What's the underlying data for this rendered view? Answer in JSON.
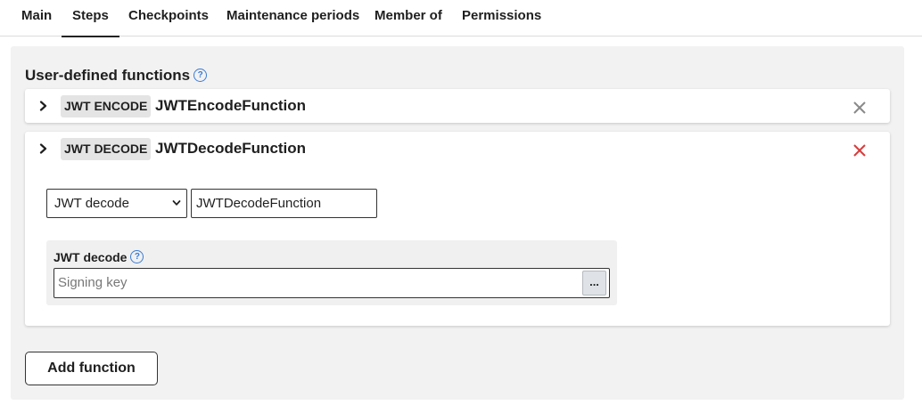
{
  "tabs": [
    {
      "label": "Main"
    },
    {
      "label": "Steps"
    },
    {
      "label": "Checkpoints"
    },
    {
      "label": "Maintenance periods"
    },
    {
      "label": "Member of"
    },
    {
      "label": "Permissions"
    }
  ],
  "active_tab": "Steps",
  "section": {
    "title": "User-defined functions",
    "help_icon": "help-circle-icon"
  },
  "functions": [
    {
      "type_badge": "JWT ENCODE",
      "name": "JWTEncodeFunction",
      "expanded": false,
      "close_icon": "close-icon",
      "close_color": "#8a8a8a"
    },
    {
      "type_badge": "JWT DECODE",
      "name": "JWTDecodeFunction",
      "expanded": true,
      "close_icon": "close-icon",
      "close_color": "#d93c3c"
    }
  ],
  "editor": {
    "type_select_value": "JWT decode",
    "name_input_value": "JWTDecodeFunction",
    "sub_label": "JWT decode",
    "signing_key_placeholder": "Signing key",
    "browse_button_label": "..."
  },
  "add_button_label": "Add function",
  "colors": {
    "accent_blue": "#3a7bd5",
    "panel_bg": "#f2f2f2",
    "badge_bg": "#e4e4e4",
    "delete_red": "#d93c3c"
  }
}
